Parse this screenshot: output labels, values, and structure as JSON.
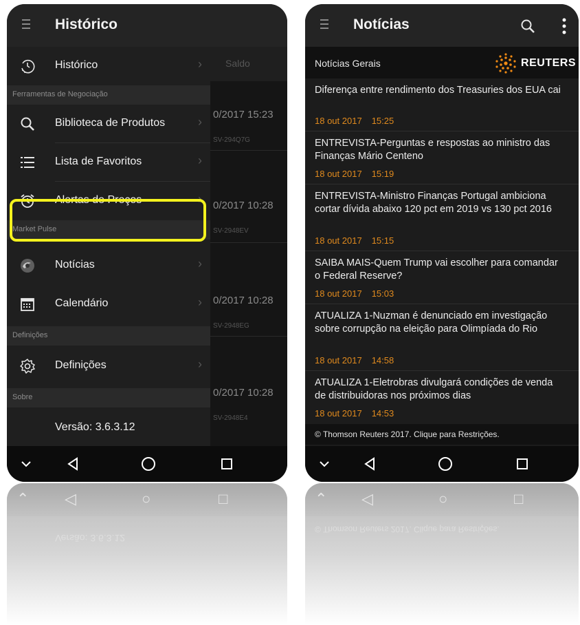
{
  "left": {
    "title": "Histórico",
    "background_column_header": "Saldo",
    "background_rows": [
      {
        "date": "0/2017 15:23",
        "code": "SV-294Q7G"
      },
      {
        "date": "0/2017 10:28",
        "code": "SV-2948EV"
      },
      {
        "date": "0/2017 10:28",
        "code": "SV-2948EG"
      },
      {
        "date": "0/2017 10:28",
        "code": "SV-2948E4"
      }
    ],
    "menu": {
      "historico": "Histórico",
      "section_tools": "Ferramentas de Negociação",
      "biblioteca": "Biblioteca de Produtos",
      "favoritos": "Lista de Favoritos",
      "alertas": "Alertas de Preços",
      "section_market": "Market Pulse",
      "noticias": "Notícias",
      "calendario": "Calendário",
      "section_definicoes": "Definições",
      "definicoes": "Definições",
      "section_sobre": "Sobre",
      "versao": "Versão: 3.6.3.12"
    },
    "highlight_color": "#f4f21e"
  },
  "right": {
    "title": "Notícias",
    "header_label": "Notícias Gerais",
    "brand": "REUTERS",
    "news": [
      {
        "headline": "Diferença entre rendimento dos Treasuries dos EUA cai",
        "date": "18 out 2017",
        "time": "15:25"
      },
      {
        "headline": "ENTREVISTA-Perguntas e respostas ao ministro das Finanças Mário Centeno",
        "date": "18 out 2017",
        "time": "15:19"
      },
      {
        "headline": "ENTREVISTA-Ministro Finanças Portugal ambiciona cortar dívida abaixo 120 pct em 2019 vs 130 pct 2016",
        "date": "18 out 2017",
        "time": "15:15"
      },
      {
        "headline": "SAIBA MAIS-Quem Trump vai escolher para comandar o Federal Reserve?",
        "date": "18 out 2017",
        "time": "15:03"
      },
      {
        "headline": "ATUALIZA 1-Nuzman é denunciado em investigação sobre corrupção na eleição para Olimpíada do Rio",
        "date": "18 out 2017",
        "time": "14:58"
      },
      {
        "headline": "ATUALIZA 1-Eletrobras divulgará condições de venda de distribuidoras nos próximos dias",
        "date": "18 out 2017",
        "time": "14:53"
      }
    ],
    "footer": "© Thomson Reuters 2017. Clique para Restrições.",
    "time_color": "#e08a1e"
  },
  "reflection_texts": {
    "left_version": "Versão: 3.6.3.12",
    "right_footer": "© Thomson Reuters 2017. Clique para Restrições."
  }
}
